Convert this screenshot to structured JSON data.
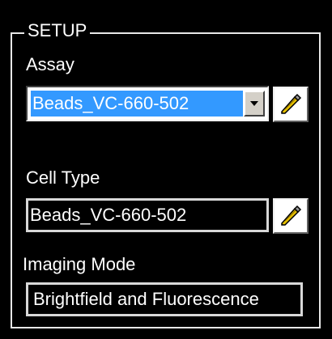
{
  "setup": {
    "title": "SETUP",
    "assay": {
      "label": "Assay",
      "selected": "Beads_VC-660-502"
    },
    "cell_type": {
      "label": "Cell Type",
      "value": "Beads_VC-660-502"
    },
    "imaging_mode": {
      "label": "Imaging Mode",
      "value": "Brightfield and Fluorescence"
    }
  },
  "icons": {
    "edit": "pencil-icon",
    "dropdown": "chevron-down-icon"
  },
  "colors": {
    "background": "#000000",
    "selection": "#3399ff",
    "text": "#ffffff"
  }
}
